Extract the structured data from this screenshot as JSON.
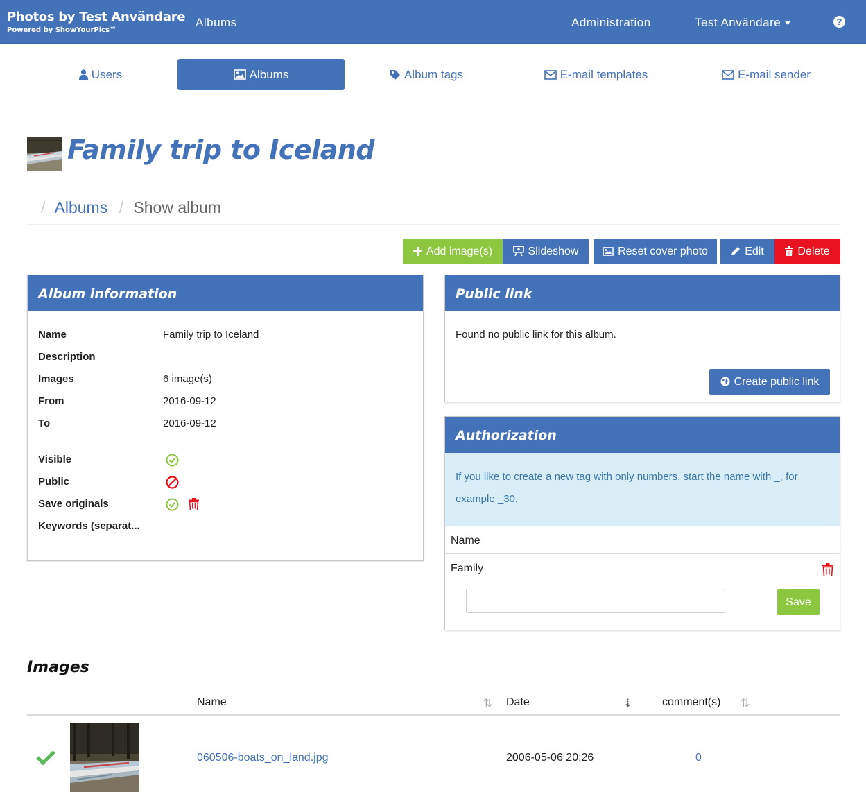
{
  "navbar": {
    "brand_title": "Photos by Test Användare",
    "brand_sub": "Powered by ShowYourPics™",
    "albums": "Albums",
    "administration": "Administration",
    "user": "Test Användare",
    "help": "?"
  },
  "subnav": {
    "users": "Users",
    "albums": "Albums",
    "album_tags": "Album tags",
    "email_templates": "E-mail templates",
    "email_sender": "E-mail sender"
  },
  "page": {
    "title": "Family trip to Iceland"
  },
  "breadcrumb": {
    "albums": "Albums",
    "current": "Show album"
  },
  "actions": {
    "add_images": "Add image(s)",
    "slideshow": "Slideshow",
    "reset_cover": "Reset cover photo",
    "edit": "Edit",
    "delete": "Delete"
  },
  "album_info": {
    "heading": "Album information",
    "name_label": "Name",
    "name_value": "Family trip to Iceland",
    "description_label": "Description",
    "images_label": "Images",
    "images_value": "6 image(s)",
    "from_label": "From",
    "from_value": "2016-09-12",
    "to_label": "To",
    "to_value": "2016-09-12",
    "visible_label": "Visible",
    "public_label": "Public",
    "save_originals_label": "Save originals",
    "keywords_label": "Keywords (separat..."
  },
  "public_link": {
    "heading": "Public link",
    "message": "Found no public link for this album.",
    "create_button": "Create public link"
  },
  "authorization": {
    "heading": "Authorization",
    "info": "If you like to create a new tag with only numbers, start the name with _, for example _30.",
    "col_name": "Name",
    "tag": "Family",
    "save_button": "Save",
    "input_value": ""
  },
  "images": {
    "heading": "Images",
    "col_name": "Name",
    "col_date": "Date",
    "col_comments": "comment(s)",
    "rows": [
      {
        "name": "060506-boats_on_land.jpg",
        "date": "2006-05-06 20:26",
        "comments": "0"
      }
    ]
  },
  "colors": {
    "primary": "#4472b9",
    "success": "#8dc63f",
    "danger": "#e8131f",
    "info_bg": "#d9edf7"
  }
}
